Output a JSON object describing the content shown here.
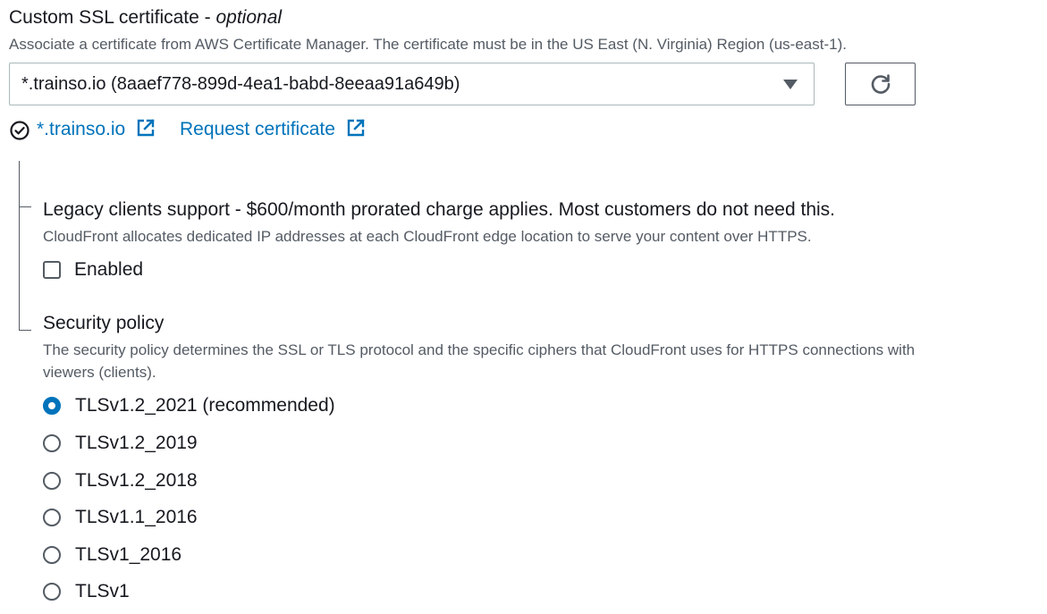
{
  "cert_field": {
    "label": "Custom SSL certificate",
    "label_suffix": "optional",
    "description": "Associate a certificate from AWS Certificate Manager. The certificate must be in the US East (N. Virginia) Region (us-east-1).",
    "selected_value": "*.trainso.io (8aaef778-899d-4ea1-babd-8eeaa91a649b)",
    "caret_icon": "caret-down-icon",
    "refresh_icon": "refresh-icon",
    "status_icon": "check-circle-icon",
    "domain_link": "*.trainso.io",
    "request_link": "Request certificate",
    "external_icon": "external-link-icon"
  },
  "legacy": {
    "title": "Legacy clients support - $600/month prorated charge applies. Most customers do not need this.",
    "description": "CloudFront allocates dedicated IP addresses at each CloudFront edge location to serve your content over HTTPS.",
    "checkbox_label": "Enabled",
    "checked": false
  },
  "security_policy": {
    "title": "Security policy",
    "description_line1": "The security policy determines the SSL or TLS protocol and the specific ciphers that CloudFront uses for HTTPS connections with",
    "description_line2": "viewers (clients).",
    "options": [
      {
        "label": "TLSv1.2_2021 (recommended)",
        "checked": true
      },
      {
        "label": "TLSv1.2_2019",
        "checked": false
      },
      {
        "label": "TLSv1.2_2018",
        "checked": false
      },
      {
        "label": "TLSv1.1_2016",
        "checked": false
      },
      {
        "label": "TLSv1_2016",
        "checked": false
      },
      {
        "label": "TLSv1",
        "checked": false
      }
    ]
  },
  "colors": {
    "link": "#0073bb",
    "text": "#16191f",
    "secondary_text": "#545b64",
    "border": "#aab7b8"
  }
}
